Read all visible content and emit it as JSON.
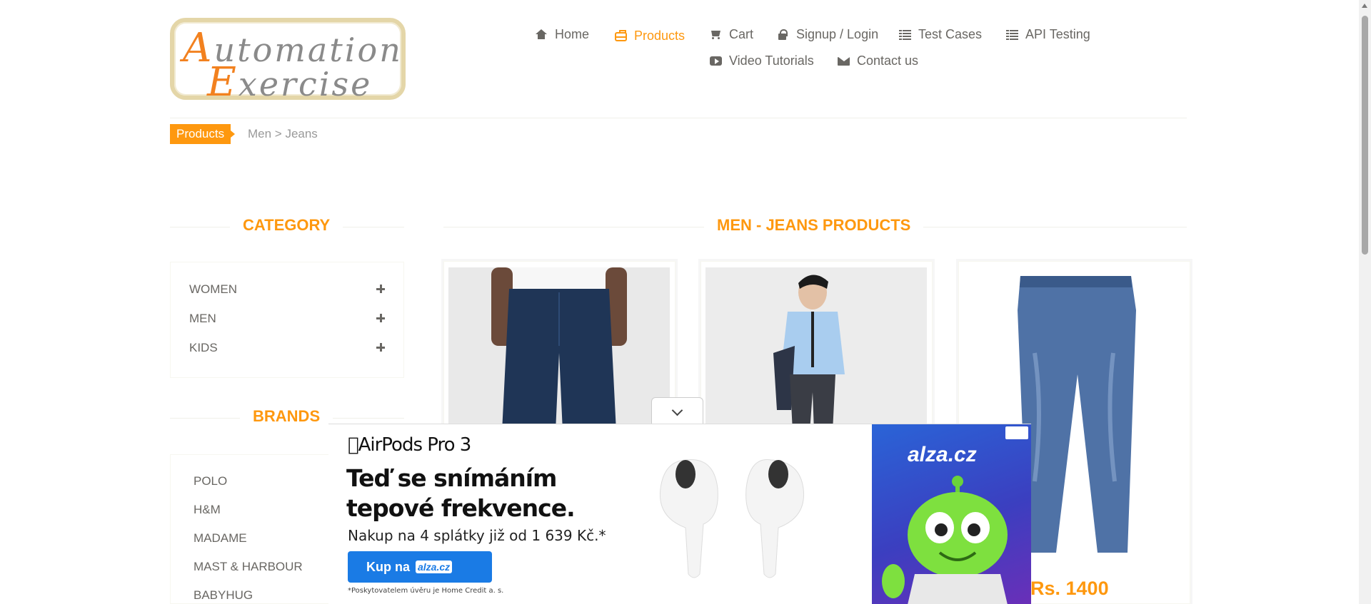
{
  "logo": {
    "line1": "utomation",
    "cap1": "A",
    "line2": "xercise",
    "cap2": "E",
    "alt": "Automation Exercise"
  },
  "nav": {
    "home": "Home",
    "products": "Products",
    "cart": "Cart",
    "login": "Signup / Login",
    "test_cases": "Test Cases",
    "api_testing": "API Testing",
    "video": "Video Tutorials",
    "contact": "Contact us"
  },
  "breadcrumb": {
    "active": "Products",
    "path": "Men > Jeans"
  },
  "sidebar": {
    "category_title": "CATEGORY",
    "categories": [
      "WOMEN",
      "MEN",
      "KIDS"
    ],
    "brands_title": "BRANDS",
    "brands": [
      "POLO",
      "H&M",
      "MADAME",
      "MAST & HARBOUR",
      "BABYHUG"
    ]
  },
  "main": {
    "title": "MEN - JEANS PRODUCTS",
    "products": [
      {
        "image": "jeans-front-model"
      },
      {
        "image": "shirt-tie-model"
      },
      {
        "image": "distressed-blue-jeans",
        "price": "Rs. 1400"
      }
    ]
  },
  "ad": {
    "product": "AirPods Pro 3",
    "headline_1": "Teď se snímáním",
    "headline_2": "tepové frekvence.",
    "sub": "Nakup na 4 splátky již od 1 639 Kč.*",
    "cta_prefix": "Kup na",
    "cta_brand": "alza.cz",
    "brand": "alza.cz",
    "footnote": "*Poskytovatelem úvěru je Home Credit a. s."
  },
  "colors": {
    "accent": "#fe980f",
    "text": "#696763",
    "ad_blue": "#1a7be5"
  }
}
